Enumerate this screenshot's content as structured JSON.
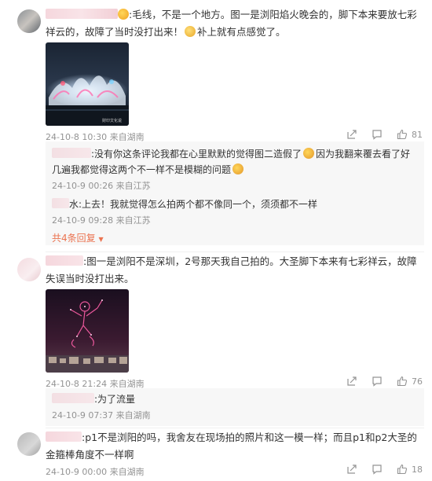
{
  "comments": [
    {
      "text": ":毛线，不是一个地方。图一是浏阳焰火晚会的，脚下本来要放七彩祥云的，故障了当时没打出来！",
      "text_tail": "补上就有点感觉了。",
      "time": "24-10-8 10:30",
      "location": "来自湖南",
      "likes": "81",
      "photo_caption": "财印文化说",
      "replies": [
        {
          "text_a": ":没有你这条评论我都在心里默默的觉得图二造假了",
          "text_b": "因为我翻来覆去看了好几遍我都觉得这两个不一样不是模糊的问题",
          "time": "24-10-9 00:26",
          "location": "来自江苏"
        },
        {
          "text": "水:上去！我就觉得怎么拍两个都不像同一个，须须都不一样",
          "time": "24-10-9 09:28",
          "location": "来自江苏"
        }
      ],
      "more_replies": "共4条回复"
    },
    {
      "text": ":图一是浏阳不是深圳，2号那天我自己拍的。大圣脚下本来有七彩祥云，故障失误当时没打出来。",
      "time": "24-10-8 21:24",
      "location": "来自湖南",
      "likes": "76",
      "replies": [
        {
          "text": ":为了流量",
          "time": "24-10-9 07:37",
          "location": "来自湖南"
        }
      ]
    },
    {
      "text": ":p1不是浏阳的吗，我舍友在现场拍的照片和这一模一样；而且p1和p2大圣的金箍棒角度不一样啊",
      "time": "24-10-9 00:00",
      "location": "来自湖南",
      "likes": "18"
    }
  ],
  "colors": {
    "link": "#eb7350",
    "meta": "#939393",
    "reply_bg": "#f7f7f7"
  }
}
